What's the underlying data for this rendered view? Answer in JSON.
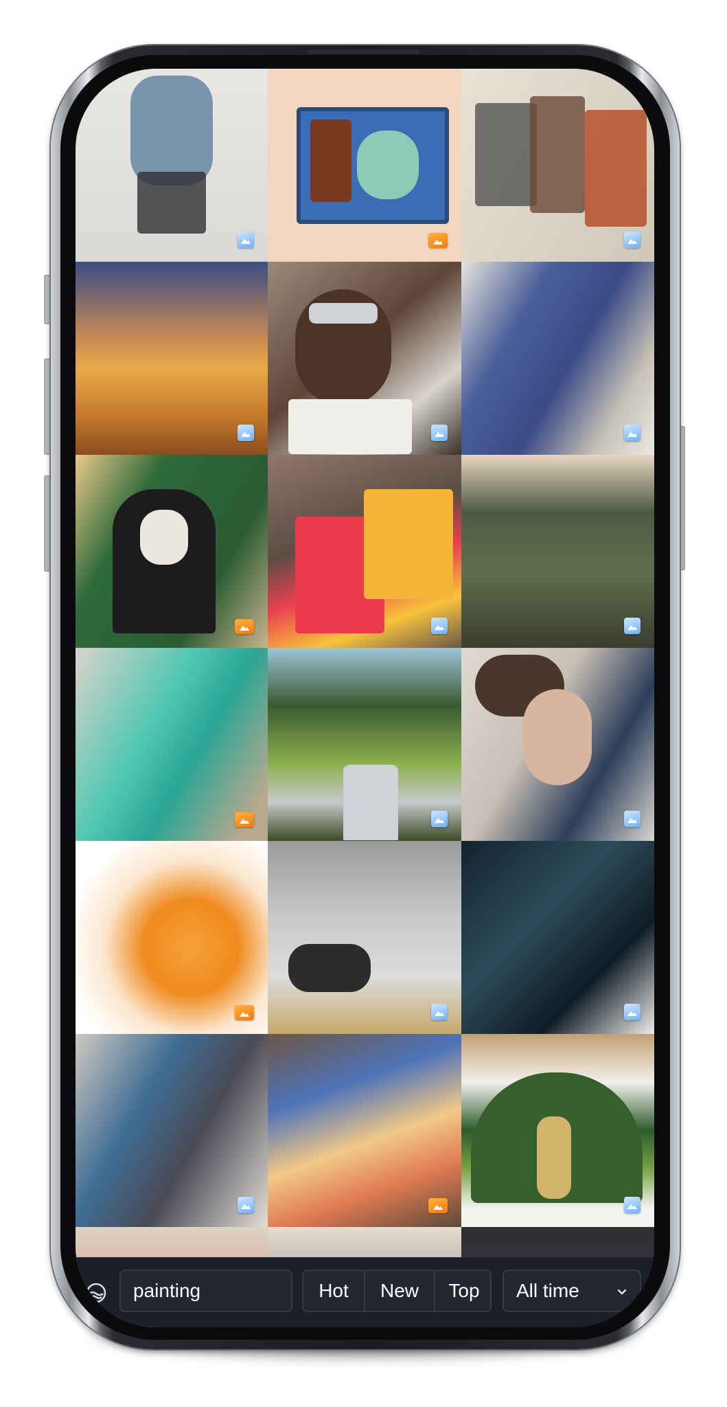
{
  "search": {
    "value": "painting"
  },
  "sort": {
    "options": [
      "Hot",
      "New",
      "Top"
    ]
  },
  "time_filter": {
    "selected": "All time"
  },
  "feed": {
    "tiles": [
      {
        "index": 1,
        "badge": "image-icon-blue"
      },
      {
        "index": 2,
        "badge": "gallery-icon-orange"
      },
      {
        "index": 3,
        "badge": "image-icon-blue"
      },
      {
        "index": 4,
        "badge": "image-icon-blue"
      },
      {
        "index": 5,
        "badge": "image-icon-blue"
      },
      {
        "index": 6,
        "badge": "image-icon-blue"
      },
      {
        "index": 7,
        "badge": "gallery-icon-orange"
      },
      {
        "index": 8,
        "badge": "image-icon-blue"
      },
      {
        "index": 9,
        "badge": "image-icon-blue"
      },
      {
        "index": 10,
        "badge": "gallery-icon-orange"
      },
      {
        "index": 11,
        "badge": "image-icon-blue"
      },
      {
        "index": 12,
        "badge": "image-icon-blue"
      },
      {
        "index": 13,
        "badge": "gallery-icon-orange"
      },
      {
        "index": 14,
        "badge": "image-icon-blue"
      },
      {
        "index": 15,
        "badge": "image-icon-blue"
      },
      {
        "index": 16,
        "badge": "image-icon-blue"
      },
      {
        "index": 17,
        "badge": "gallery-icon-orange"
      },
      {
        "index": 18,
        "badge": "image-icon-blue"
      }
    ]
  },
  "colors": {
    "bar_background": "#1c1f27",
    "control_background": "#232732",
    "control_border": "#353a46",
    "badge_blue": "#6fb0f5",
    "badge_orange": "#f07a12"
  }
}
